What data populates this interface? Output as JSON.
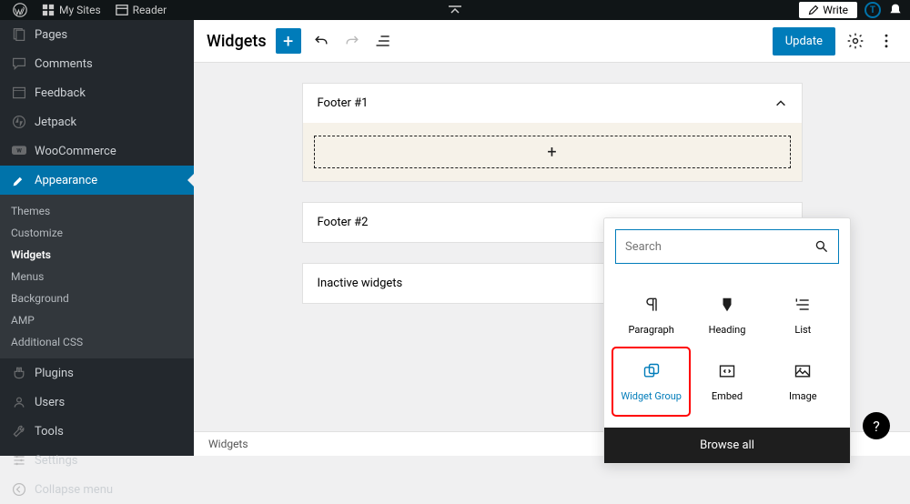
{
  "topbar": {
    "mysites": "My Sites",
    "reader": "Reader",
    "write": "Write",
    "avatar_letter": "T"
  },
  "sidebar": {
    "items": [
      {
        "label": "Pages"
      },
      {
        "label": "Comments"
      },
      {
        "label": "Feedback"
      },
      {
        "label": "Jetpack"
      },
      {
        "label": "WooCommerce"
      },
      {
        "label": "Appearance",
        "active": true
      }
    ],
    "appearance_sub": [
      {
        "label": "Themes"
      },
      {
        "label": "Customize"
      },
      {
        "label": "Widgets",
        "current": true
      },
      {
        "label": "Menus"
      },
      {
        "label": "Background"
      },
      {
        "label": "AMP"
      },
      {
        "label": "Additional CSS"
      }
    ],
    "lower": [
      {
        "label": "Plugins"
      },
      {
        "label": "Users"
      },
      {
        "label": "Tools"
      },
      {
        "label": "Settings"
      },
      {
        "label": "Collapse menu"
      }
    ]
  },
  "header": {
    "title": "Widgets",
    "update": "Update"
  },
  "widget_areas": [
    {
      "name": "Footer #1",
      "open": true
    },
    {
      "name": "Footer #2",
      "open": false
    },
    {
      "name": "Inactive widgets",
      "open": false
    }
  ],
  "inserter": {
    "search_placeholder": "Search",
    "blocks": [
      {
        "label": "Paragraph"
      },
      {
        "label": "Heading"
      },
      {
        "label": "List"
      },
      {
        "label": "Widget Group",
        "highlight": true
      },
      {
        "label": "Embed"
      },
      {
        "label": "Image"
      }
    ],
    "browse": "Browse all"
  },
  "footer": {
    "crumb": "Widgets"
  },
  "help": "?"
}
